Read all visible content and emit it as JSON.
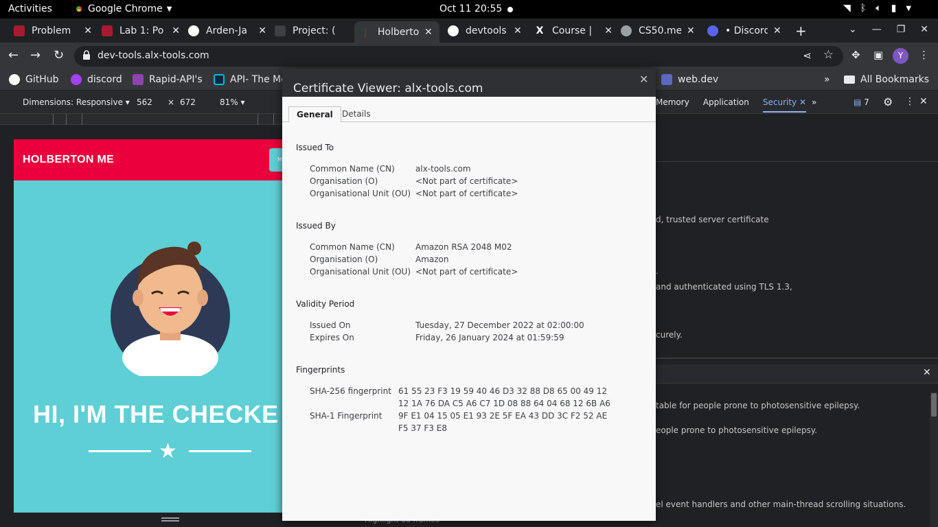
{
  "system": {
    "activities": "Activities",
    "app_name": "Google Chrome",
    "clock": "Oct 11  20:55"
  },
  "browser": {
    "tabs": [
      {
        "title": "Problem",
        "favicon_color": "#a51c30"
      },
      {
        "title": "Lab 1: Po",
        "favicon_color": "#a51c30"
      },
      {
        "title": "Arden-Ja",
        "favicon_color": "#ffffff"
      },
      {
        "title": "Project: (",
        "favicon_color": "#3c4043"
      },
      {
        "title": "Holberto",
        "favicon_color": "#e9003d"
      },
      {
        "title": "devtools",
        "favicon_color": "#ffffff"
      },
      {
        "title": "Course |",
        "favicon_color": "#202124"
      },
      {
        "title": "CS50.me",
        "favicon_color": "#9aa0a6"
      },
      {
        "title": "• Discord",
        "favicon_color": "#5865f2"
      }
    ],
    "url": "dev-tools.alx-tools.com",
    "profile_initial": "Y",
    "bookmarks": [
      {
        "label": "GitHub"
      },
      {
        "label": "discord"
      },
      {
        "label": "Rapid-API's"
      },
      {
        "label": "API- The Mo"
      },
      {
        "label": "web.dev"
      }
    ],
    "all_bookmarks": "All Bookmarks"
  },
  "devtools": {
    "dimensions_label": "Dimensions: Responsive ▾",
    "width": "562",
    "times": "×",
    "height": "672",
    "zoom": "81% ▾",
    "tabs": [
      "Memory",
      "Application",
      "Security"
    ],
    "active_tab": "Security",
    "issues_count": "7",
    "panel_lines": [
      "d, trusted server certificate",
      ".",
      "and authenticated using TLS 1.3,",
      "curely."
    ],
    "rendering_lines": [
      "table for people prone to photosensitive epilepsy.",
      "eople prone to photosensitive epilepsy.",
      "el event handlers and other main-thread scrolling situations."
    ],
    "bottom_snippet": "Highlight ad frames"
  },
  "preview": {
    "brand": "HOLBERTON ME",
    "menu": "M",
    "headline": "HI, I'M THE CHECKE"
  },
  "certificate": {
    "title": "Certificate Viewer: alx-tools.com",
    "tabs": {
      "general": "General",
      "details": "Details"
    },
    "issued_to": {
      "heading": "Issued To",
      "rows": [
        {
          "label": "Common Name (CN)",
          "value": "alx-tools.com"
        },
        {
          "label": "Organisation (O)",
          "value": "<Not part of certificate>"
        },
        {
          "label": "Organisational Unit (OU)",
          "value": "<Not part of certificate>"
        }
      ]
    },
    "issued_by": {
      "heading": "Issued By",
      "rows": [
        {
          "label": "Common Name (CN)",
          "value": "Amazon RSA 2048 M02"
        },
        {
          "label": "Organisation (O)",
          "value": "Amazon"
        },
        {
          "label": "Organisational Unit (OU)",
          "value": "<Not part of certificate>"
        }
      ]
    },
    "validity": {
      "heading": "Validity Period",
      "rows": [
        {
          "label": "Issued On",
          "value": "Tuesday, 27 December 2022 at 02:00:00"
        },
        {
          "label": "Expires On",
          "value": "Friday, 26 January 2024 at 01:59:59"
        }
      ]
    },
    "fingerprints": {
      "heading": "Fingerprints",
      "sha256_label": "SHA-256 fingerprint",
      "sha256_line1": "61 55 23 F3 19 59 40 46 D3 32 88 D8 65 00 49 12",
      "sha256_line2": "12 1A 76 DA C5 A6 C7 1D 08 88 64 04 68 12 6B A6",
      "sha1_label": "SHA-1 Fingerprint",
      "sha1_line1": "9F E1 04 15 05 E1 93 2E 5F EA 43 DD 3C F2 52 AE",
      "sha1_line2": "F5 37 F3 E8"
    }
  }
}
